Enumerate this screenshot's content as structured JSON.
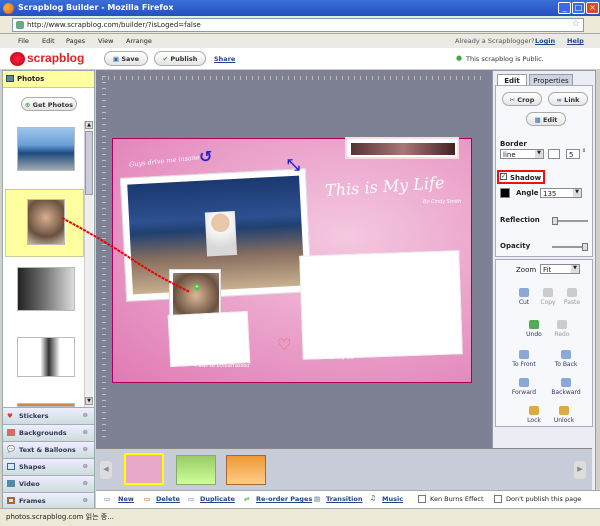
{
  "window": {
    "title": "Scrapblog Builder - Mozilla Firefox"
  },
  "browser": {
    "url": "http://www.scrapblog.com/builder/?isLoged=false",
    "status": "photos.scrapblog.com 읽는 중..."
  },
  "menu": {
    "file": "File",
    "edit": "Edit",
    "pages": "Pages",
    "view": "View",
    "arrange": "Arrange",
    "already": "Already a Scrapblogger?",
    "login": "Login",
    "help": "Help"
  },
  "appbar": {
    "logo": "scrapblog",
    "save": "Save",
    "publish": "Publish",
    "share": "Share",
    "public_note": "This scrapblog is Public."
  },
  "left": {
    "photos": "Photos",
    "get_photos": "Get Photos",
    "categories": [
      "Stickers",
      "Backgrounds",
      "Text & Balloons",
      "Shapes",
      "Video",
      "Frames"
    ]
  },
  "canvas": {
    "title_text": "This is My Life",
    "byline": "By Cindy Smith",
    "caption_top": "Guys drive me insane",
    "caption_bottom_left": "I was so embarrassed",
    "caption_bottom_right": "the love of my life"
  },
  "right": {
    "tabs": {
      "edit": "Edit",
      "properties": "Properties"
    },
    "crop": "Crop",
    "link": "Link",
    "edit_btn": "Edit",
    "border_label": "Border",
    "border_style": "line",
    "border_width": "5",
    "shadow": "Shadow",
    "angle_label": "Angle",
    "angle_value": "135",
    "reflection": "Reflection",
    "opacity": "Opacity",
    "zoom_label": "Zoom",
    "zoom_value": "Fit",
    "tools": {
      "cut": "Cut",
      "copy": "Copy",
      "paste": "Paste",
      "undo": "Undo",
      "redo": "Redo",
      "to_front": "To Front",
      "to_back": "To Back",
      "forward": "Forward",
      "backward": "Backward",
      "lock": "Lock",
      "unlock": "Unlock"
    }
  },
  "bottom": {
    "new": "New",
    "delete": "Delete",
    "duplicate": "Duplicate",
    "reorder": "Re-order Pages",
    "transition": "Transition",
    "music": "Music",
    "ken_burns": "Ken Burns Effect",
    "dont_publish": "Don't publish this page"
  }
}
